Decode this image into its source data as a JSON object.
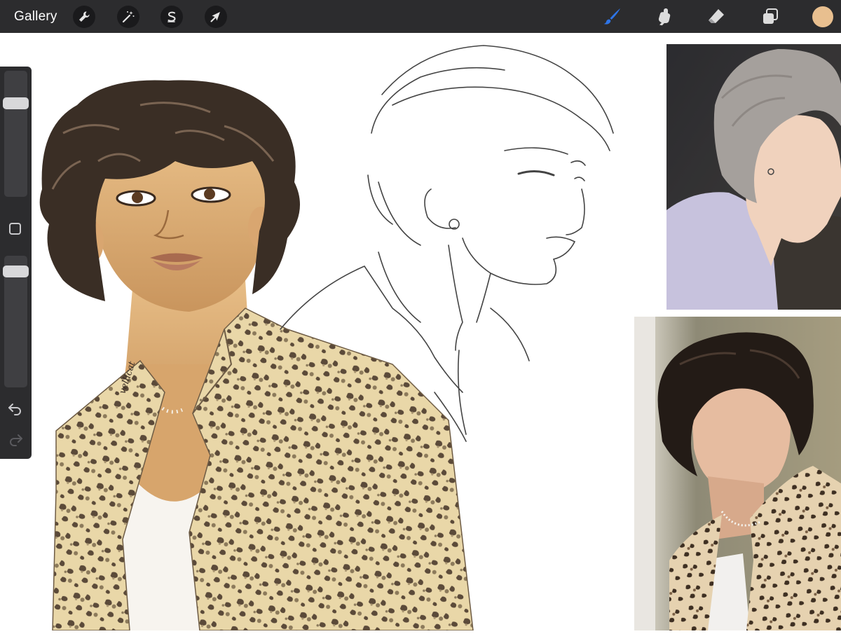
{
  "topbar": {
    "gallery_label": "Gallery",
    "left_tools": [
      "wrench-icon",
      "magic-wand-icon",
      "selection-icon",
      "transform-arrow-icon"
    ],
    "right_tools": [
      "brush-icon",
      "smudge-icon",
      "eraser-icon",
      "layers-icon"
    ],
    "active_tool": "brush",
    "active_tool_color": "#2e74e6",
    "current_color": "#e8bf8f"
  },
  "sidebar": {
    "brush_size_level": 0.21,
    "opacity_level": 0.06,
    "items": [
      "brush-size-slider",
      "modify-button-icon",
      "opacity-slider",
      "undo-icon",
      "redo-icon"
    ]
  },
  "canvas": {
    "signature_text": "vellicat",
    "artworks": [
      "painted-portrait-leopard-shirt",
      "line-sketch-profile",
      "reference-photo-top",
      "reference-photo-bottom"
    ]
  }
}
